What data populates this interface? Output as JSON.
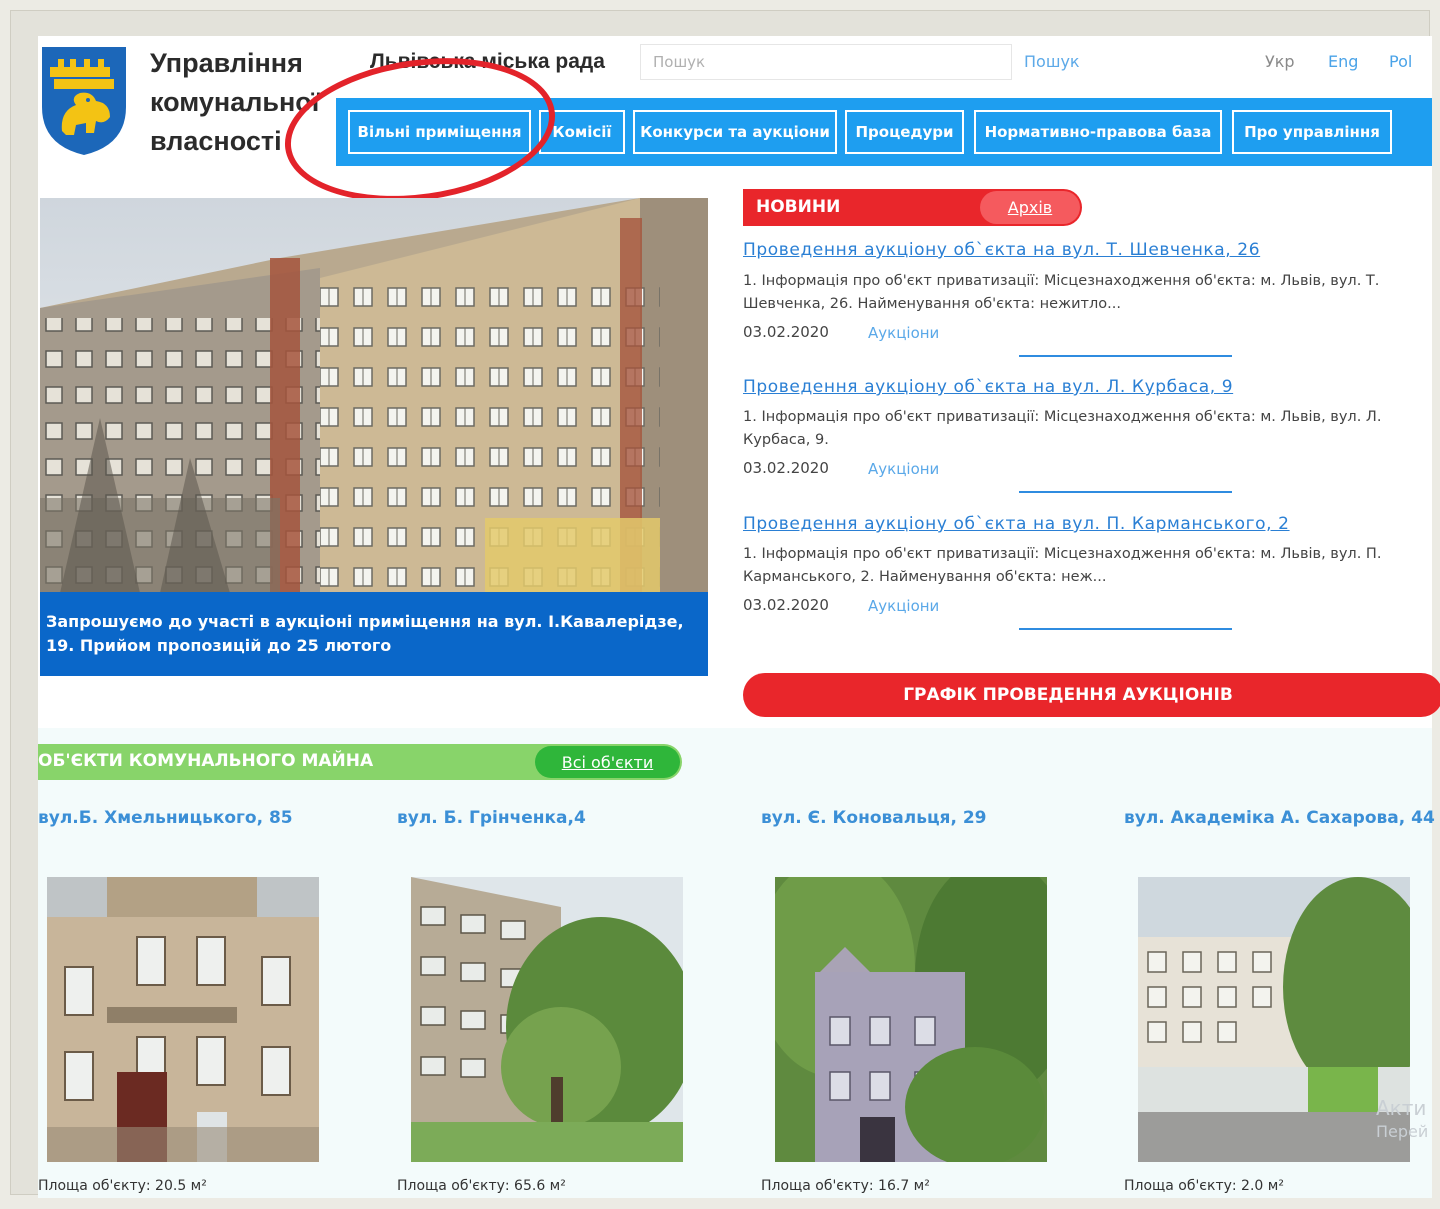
{
  "header": {
    "org_name_line1": "Управління",
    "org_name_line2": "комунальної",
    "org_name_line3": "власності",
    "council": "Львівська міська рада",
    "search_placeholder": "Пошук",
    "search_button": "Пошук",
    "languages": [
      "Укр",
      "Eng",
      "Pol"
    ]
  },
  "nav": {
    "items": [
      "Вільні приміщення",
      "Комісії",
      "Конкурси та аукціони",
      "Процедури",
      "Нормативно-правова база",
      "Про управління"
    ]
  },
  "hero": {
    "caption": "Запрошуємо до участі в аукціоні приміщення на вул. І.Кавалерідзе, 19. Прийом пропозицій до 25 лютого"
  },
  "news": {
    "title": "НОВИНИ",
    "archive": "Архів",
    "items": [
      {
        "title": "Проведення аукціону об`єкта на вул. Т. Шевченка, 26",
        "excerpt": "1. Інформація про об'єкт приватизації:   Місцезнаходження об'єкта: м. Львів, вул. Т. Шевченка, 26.   Найменування об'єкта: нежитло...",
        "date": "03.02.2020",
        "category": "Аукціони"
      },
      {
        "title": "Проведення аукціону об`єкта на вул. Л. Курбаса, 9",
        "excerpt": "1. Інформація про об'єкт приватизації:  Місцезнаходження об'єкта: м. Львів, вул. Л. Курбаса, 9.",
        "date": "03.02.2020",
        "category": "Аукціони"
      },
      {
        "title": "Проведення аукціону об`єкта на вул. П. Карманського, 2",
        "excerpt": "1. Інформація про об'єкт приватизації:    Місцезнаходження об'єкта: м. Львів, вул. П. Карманського, 2.   Найменування об'єкта: неж...",
        "date": "03.02.2020",
        "category": "Аукціони"
      }
    ],
    "schedule_button": "ГРАФІК ПРОВЕДЕННЯ АУКЦІОНІВ"
  },
  "objects": {
    "title": "ОБ'ЄКТИ КОМУНАЛЬНОГО МАЙНА",
    "all_button": "Всі об'єкти",
    "items": [
      {
        "address": "вул.Б. Хмельницького, 85",
        "area": "Площа об'єкту: 20.5 м²"
      },
      {
        "address": "вул. Б. Грінченка,4",
        "area": "Площа об'єкту: 65.6 м²"
      },
      {
        "address": "вул. Є. Коновальця, 29",
        "area": "Площа об'єкту: 16.7 м²"
      },
      {
        "address": "вул. Академіка А. Сахарова, 44",
        "area": "Площа об'єкту: 2.0 м²"
      }
    ]
  },
  "watermark": {
    "line1": "Акти",
    "line2": "Перей"
  },
  "colors": {
    "nav_blue": "#1e9ef0",
    "news_red": "#e9262b",
    "objects_green": "#88d46a",
    "link_blue": "#2a7fd4",
    "annotation_red": "#e3232a"
  }
}
